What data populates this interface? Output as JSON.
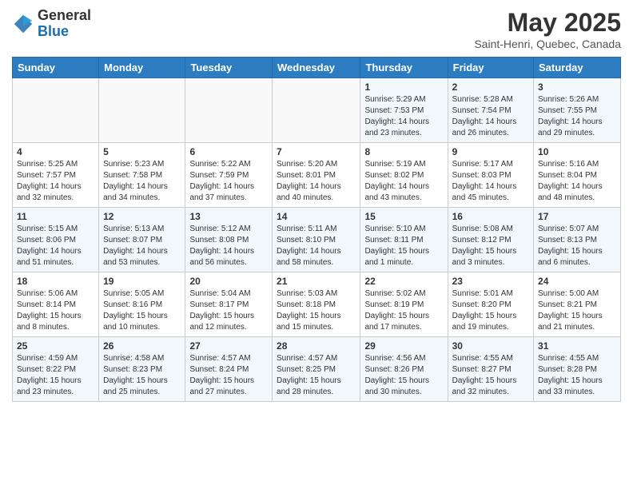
{
  "logo": {
    "general": "General",
    "blue": "Blue"
  },
  "title": "May 2025",
  "location": "Saint-Henri, Quebec, Canada",
  "weekdays": [
    "Sunday",
    "Monday",
    "Tuesday",
    "Wednesday",
    "Thursday",
    "Friday",
    "Saturday"
  ],
  "weeks": [
    [
      {
        "day": "",
        "info": ""
      },
      {
        "day": "",
        "info": ""
      },
      {
        "day": "",
        "info": ""
      },
      {
        "day": "",
        "info": ""
      },
      {
        "day": "1",
        "info": "Sunrise: 5:29 AM\nSunset: 7:53 PM\nDaylight: 14 hours\nand 23 minutes."
      },
      {
        "day": "2",
        "info": "Sunrise: 5:28 AM\nSunset: 7:54 PM\nDaylight: 14 hours\nand 26 minutes."
      },
      {
        "day": "3",
        "info": "Sunrise: 5:26 AM\nSunset: 7:55 PM\nDaylight: 14 hours\nand 29 minutes."
      }
    ],
    [
      {
        "day": "4",
        "info": "Sunrise: 5:25 AM\nSunset: 7:57 PM\nDaylight: 14 hours\nand 32 minutes."
      },
      {
        "day": "5",
        "info": "Sunrise: 5:23 AM\nSunset: 7:58 PM\nDaylight: 14 hours\nand 34 minutes."
      },
      {
        "day": "6",
        "info": "Sunrise: 5:22 AM\nSunset: 7:59 PM\nDaylight: 14 hours\nand 37 minutes."
      },
      {
        "day": "7",
        "info": "Sunrise: 5:20 AM\nSunset: 8:01 PM\nDaylight: 14 hours\nand 40 minutes."
      },
      {
        "day": "8",
        "info": "Sunrise: 5:19 AM\nSunset: 8:02 PM\nDaylight: 14 hours\nand 43 minutes."
      },
      {
        "day": "9",
        "info": "Sunrise: 5:17 AM\nSunset: 8:03 PM\nDaylight: 14 hours\nand 45 minutes."
      },
      {
        "day": "10",
        "info": "Sunrise: 5:16 AM\nSunset: 8:04 PM\nDaylight: 14 hours\nand 48 minutes."
      }
    ],
    [
      {
        "day": "11",
        "info": "Sunrise: 5:15 AM\nSunset: 8:06 PM\nDaylight: 14 hours\nand 51 minutes."
      },
      {
        "day": "12",
        "info": "Sunrise: 5:13 AM\nSunset: 8:07 PM\nDaylight: 14 hours\nand 53 minutes."
      },
      {
        "day": "13",
        "info": "Sunrise: 5:12 AM\nSunset: 8:08 PM\nDaylight: 14 hours\nand 56 minutes."
      },
      {
        "day": "14",
        "info": "Sunrise: 5:11 AM\nSunset: 8:10 PM\nDaylight: 14 hours\nand 58 minutes."
      },
      {
        "day": "15",
        "info": "Sunrise: 5:10 AM\nSunset: 8:11 PM\nDaylight: 15 hours\nand 1 minute."
      },
      {
        "day": "16",
        "info": "Sunrise: 5:08 AM\nSunset: 8:12 PM\nDaylight: 15 hours\nand 3 minutes."
      },
      {
        "day": "17",
        "info": "Sunrise: 5:07 AM\nSunset: 8:13 PM\nDaylight: 15 hours\nand 6 minutes."
      }
    ],
    [
      {
        "day": "18",
        "info": "Sunrise: 5:06 AM\nSunset: 8:14 PM\nDaylight: 15 hours\nand 8 minutes."
      },
      {
        "day": "19",
        "info": "Sunrise: 5:05 AM\nSunset: 8:16 PM\nDaylight: 15 hours\nand 10 minutes."
      },
      {
        "day": "20",
        "info": "Sunrise: 5:04 AM\nSunset: 8:17 PM\nDaylight: 15 hours\nand 12 minutes."
      },
      {
        "day": "21",
        "info": "Sunrise: 5:03 AM\nSunset: 8:18 PM\nDaylight: 15 hours\nand 15 minutes."
      },
      {
        "day": "22",
        "info": "Sunrise: 5:02 AM\nSunset: 8:19 PM\nDaylight: 15 hours\nand 17 minutes."
      },
      {
        "day": "23",
        "info": "Sunrise: 5:01 AM\nSunset: 8:20 PM\nDaylight: 15 hours\nand 19 minutes."
      },
      {
        "day": "24",
        "info": "Sunrise: 5:00 AM\nSunset: 8:21 PM\nDaylight: 15 hours\nand 21 minutes."
      }
    ],
    [
      {
        "day": "25",
        "info": "Sunrise: 4:59 AM\nSunset: 8:22 PM\nDaylight: 15 hours\nand 23 minutes."
      },
      {
        "day": "26",
        "info": "Sunrise: 4:58 AM\nSunset: 8:23 PM\nDaylight: 15 hours\nand 25 minutes."
      },
      {
        "day": "27",
        "info": "Sunrise: 4:57 AM\nSunset: 8:24 PM\nDaylight: 15 hours\nand 27 minutes."
      },
      {
        "day": "28",
        "info": "Sunrise: 4:57 AM\nSunset: 8:25 PM\nDaylight: 15 hours\nand 28 minutes."
      },
      {
        "day": "29",
        "info": "Sunrise: 4:56 AM\nSunset: 8:26 PM\nDaylight: 15 hours\nand 30 minutes."
      },
      {
        "day": "30",
        "info": "Sunrise: 4:55 AM\nSunset: 8:27 PM\nDaylight: 15 hours\nand 32 minutes."
      },
      {
        "day": "31",
        "info": "Sunrise: 4:55 AM\nSunset: 8:28 PM\nDaylight: 15 hours\nand 33 minutes."
      }
    ]
  ]
}
